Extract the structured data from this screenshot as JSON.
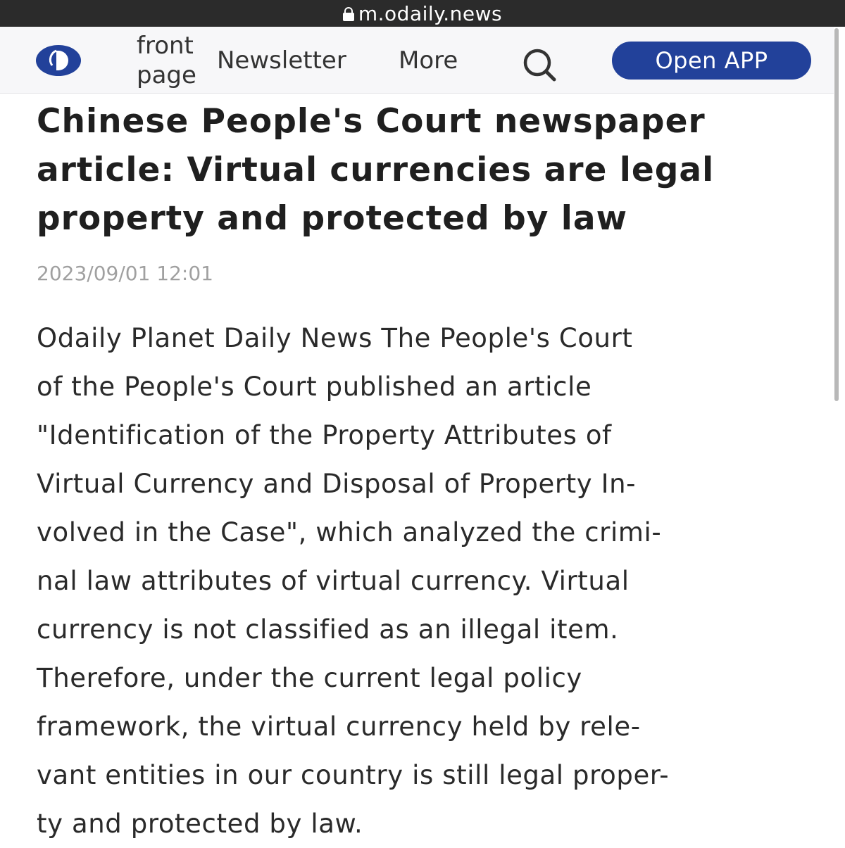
{
  "browser": {
    "url": "m.odaily.news"
  },
  "nav": {
    "front_page": "front page",
    "newsletter": "Newsletter",
    "more": "More",
    "open_app": "Open APP"
  },
  "icons": {
    "lock": "lock-icon",
    "logo": "odaily-logo-icon",
    "search": "search-icon"
  },
  "colors": {
    "brand_blue": "#22419a",
    "timestamp_gray": "#a0a0a0"
  },
  "article": {
    "title": "Chinese People's Court newspaper article: Virtual currencies are legal property and protected by law",
    "timestamp": "2023/09/01 12:01",
    "body": "Odaily Planet Daily News The People's Court\nof the People's Court published an article\n\"Identification of the Property Attributes of\nVirtual Currency and Disposal of Property In-\nvolved in the Case\", which analyzed the crimi-\nnal law attributes of virtual currency. Virtual\ncurrency is not classified as an illegal item.\nTherefore, under the current legal policy\nframework, the virtual currency held by rele-\nvant entities in our country is still legal proper-\nty and protected by law."
  }
}
